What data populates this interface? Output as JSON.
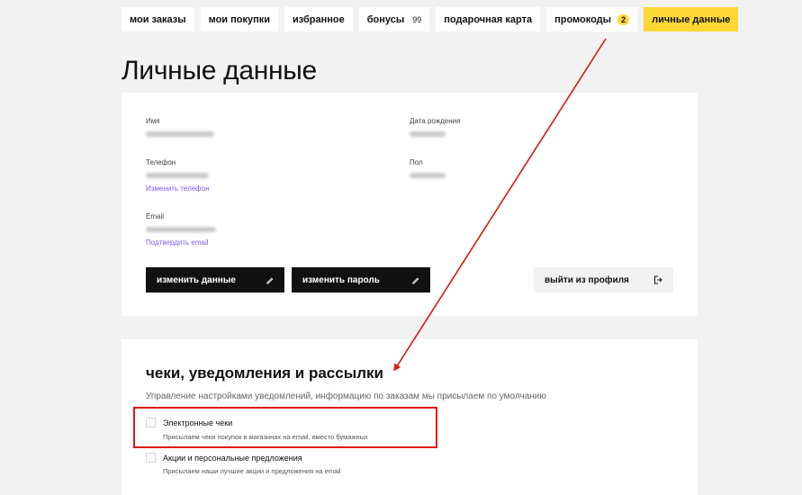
{
  "tabs": [
    {
      "label": "мои заказы"
    },
    {
      "label": "мои покупки"
    },
    {
      "label": "избранное"
    },
    {
      "label": "бонусы",
      "count": "99"
    },
    {
      "label": "подарочная карта"
    },
    {
      "label": "промокоды",
      "badge": "2"
    },
    {
      "label": "личные данные",
      "active": true
    }
  ],
  "page_title": "Личные данные",
  "profile": {
    "name_label": "Имя",
    "birth_label": "Дата рождения",
    "phone_label": "Телефон",
    "change_phone": "Изменить телефон",
    "gender_label": "Пол",
    "email_label": "Email",
    "confirm_email": "Подтвердить email"
  },
  "buttons": {
    "edit_data": "изменить данные",
    "change_password": "изменить пароль",
    "logout": "выйти из профиля"
  },
  "notifications": {
    "title": "чеки, уведомления и рассылки",
    "subtitle": "Управление настройками уведомлений, информацию по заказам мы присылаем по умолчанию",
    "options": [
      {
        "title": "Электронные чеки",
        "desc": "Присылаем чеки покупок в магазинах на email, вместо бумажных",
        "checked": false
      },
      {
        "title": "Акции и персональные предложения",
        "desc": "Присылаем наши лучшие акции и предложения на email",
        "checked": false
      }
    ]
  },
  "colors": {
    "accent_yellow": "#fdd835",
    "annotation_red": "#e01515",
    "link_purple": "#7a5cf2",
    "button_dark": "#111111"
  }
}
